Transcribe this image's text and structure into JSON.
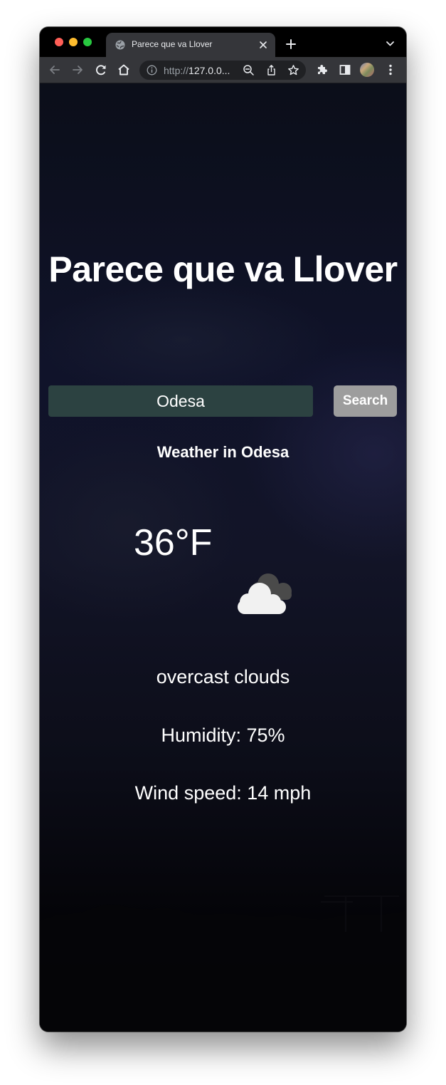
{
  "browser": {
    "tab_title": "Parece que va Llover",
    "url_prefix": "http://",
    "url_host": "127.0.0...",
    "accent": "#35363a"
  },
  "icons": {
    "favicon": "globe-icon",
    "tab_close": "close-icon",
    "new_tab": "plus-icon",
    "tab_menu": "chevron-down-icon",
    "back": "back-arrow-icon",
    "forward": "forward-arrow-icon",
    "reload": "reload-icon",
    "home": "home-icon",
    "site_info": "info-icon",
    "zoom": "zoom-out-icon",
    "share": "share-icon",
    "bookmark": "star-icon",
    "extensions": "puzzle-icon",
    "side_panel": "side-panel-icon",
    "profile": "avatar",
    "more": "kebab-menu-icon",
    "weather": "cloud-icon"
  },
  "app": {
    "title": "Parece que va Llover",
    "search": {
      "value": "Odesa",
      "button_label": "Search"
    },
    "weather": {
      "heading": "Weather in Odesa",
      "temperature": "36°F",
      "description": "overcast clouds",
      "humidity": "Humidity: 75%",
      "wind": "Wind speed: 14 mph"
    }
  },
  "colors": {
    "input_bg": "#2c4241",
    "button_bg": "#9d9d9d",
    "text": "#ffffff"
  }
}
